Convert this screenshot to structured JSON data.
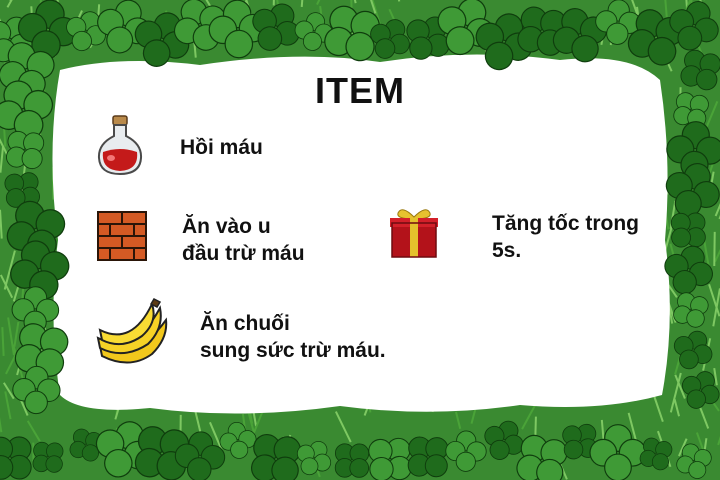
{
  "screen": {
    "title": "ITEM",
    "frame_theme": "clover-and-grass-border",
    "colors": {
      "background_panel": "#ffffff",
      "clover_dark": "#1f6b1c",
      "clover_light": "#3f9a36",
      "grass": "#4faa3a",
      "text": "#111111"
    }
  },
  "items": [
    {
      "icon": "potion-icon",
      "description_lines": [
        "Hồi máu"
      ]
    },
    {
      "icon": "brick-icon",
      "description_lines": [
        "Ăn vào u",
        "đầu trừ máu"
      ]
    },
    {
      "icon": "gift-icon",
      "description_lines": [
        "Tăng tốc trong",
        "5s."
      ]
    },
    {
      "icon": "banana-icon",
      "description_lines": [
        "Ăn chuối",
        "sung sức trừ máu."
      ]
    }
  ]
}
